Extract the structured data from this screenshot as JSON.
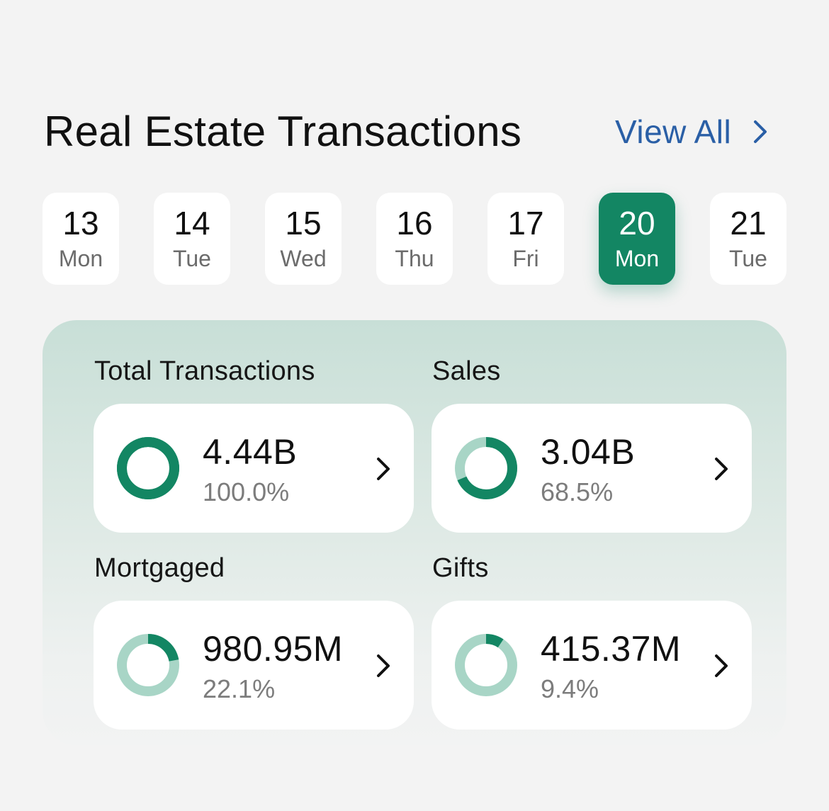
{
  "header": {
    "title": "Real Estate Transactions",
    "view_all_label": "View All"
  },
  "dates": [
    {
      "num": "13",
      "day": "Mon",
      "selected": false
    },
    {
      "num": "14",
      "day": "Tue",
      "selected": false
    },
    {
      "num": "15",
      "day": "Wed",
      "selected": false
    },
    {
      "num": "16",
      "day": "Thu",
      "selected": false
    },
    {
      "num": "17",
      "day": "Fri",
      "selected": false
    },
    {
      "num": "20",
      "day": "Mon",
      "selected": true
    },
    {
      "num": "21",
      "day": "Tue",
      "selected": false
    }
  ],
  "stats": [
    {
      "label": "Total Transactions",
      "value": "4.44B",
      "percent": "100.0%",
      "fraction": 1.0
    },
    {
      "label": "Sales",
      "value": "3.04B",
      "percent": "68.5%",
      "fraction": 0.685
    },
    {
      "label": "Mortgaged",
      "value": "980.95M",
      "percent": "22.1%",
      "fraction": 0.221
    },
    {
      "label": "Gifts",
      "value": "415.37M",
      "percent": "9.4%",
      "fraction": 0.094
    }
  ],
  "colors": {
    "accent": "#138663",
    "donut_track": "#a8d5c6",
    "link": "#2a5fa6",
    "background": "#f3f3f3"
  },
  "icons": {
    "view_all": "chevron-right-icon",
    "card": "chevron-right-icon"
  }
}
